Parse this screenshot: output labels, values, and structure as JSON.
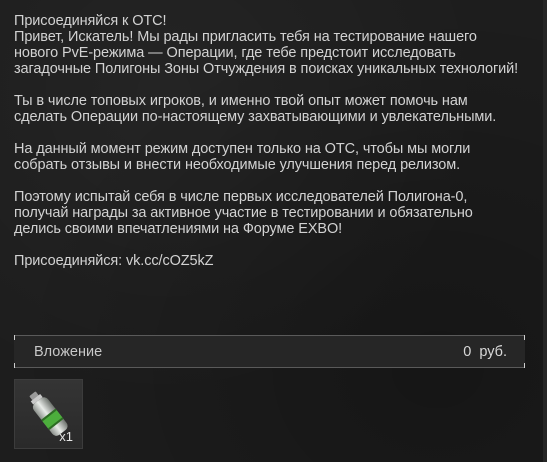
{
  "message": {
    "paragraphs": [
      "Присоединяйся к ОТС!\nПривет, Искатель! Мы рады пригласить тебя на тестирование нашего нового PvE-режима — Операции, где тебе предстоит исследовать загадочные Полигоны Зоны Отчуждения в поисках уникальных технологий!",
      "Ты в числе топовых игроков, и именно твой опыт может помочь нам сделать Операции по-настоящему захватывающими и увлекательными.",
      "На данный момент режим доступен только на ОТС, чтобы мы могли собрать отзывы и внести необходимые улучшения перед релизом.",
      "Поэтому испытай себя в числе первых исследователей Полигона-0, получай награды за активное участие в тестировании и обязательно делись своими впечатлениями на Форуме EXBO!",
      "Присоединяйся: vk.cc/cOZ5kZ"
    ]
  },
  "attachment": {
    "label": "Вложение",
    "value": "0 руб."
  },
  "item": {
    "icon": "green-canister-icon",
    "count": "x1"
  },
  "colors": {
    "background": "#1d1d1d",
    "text": "#d2d2d2",
    "bar_border": "#5a5a5a",
    "item_green": "#4cae3c"
  }
}
